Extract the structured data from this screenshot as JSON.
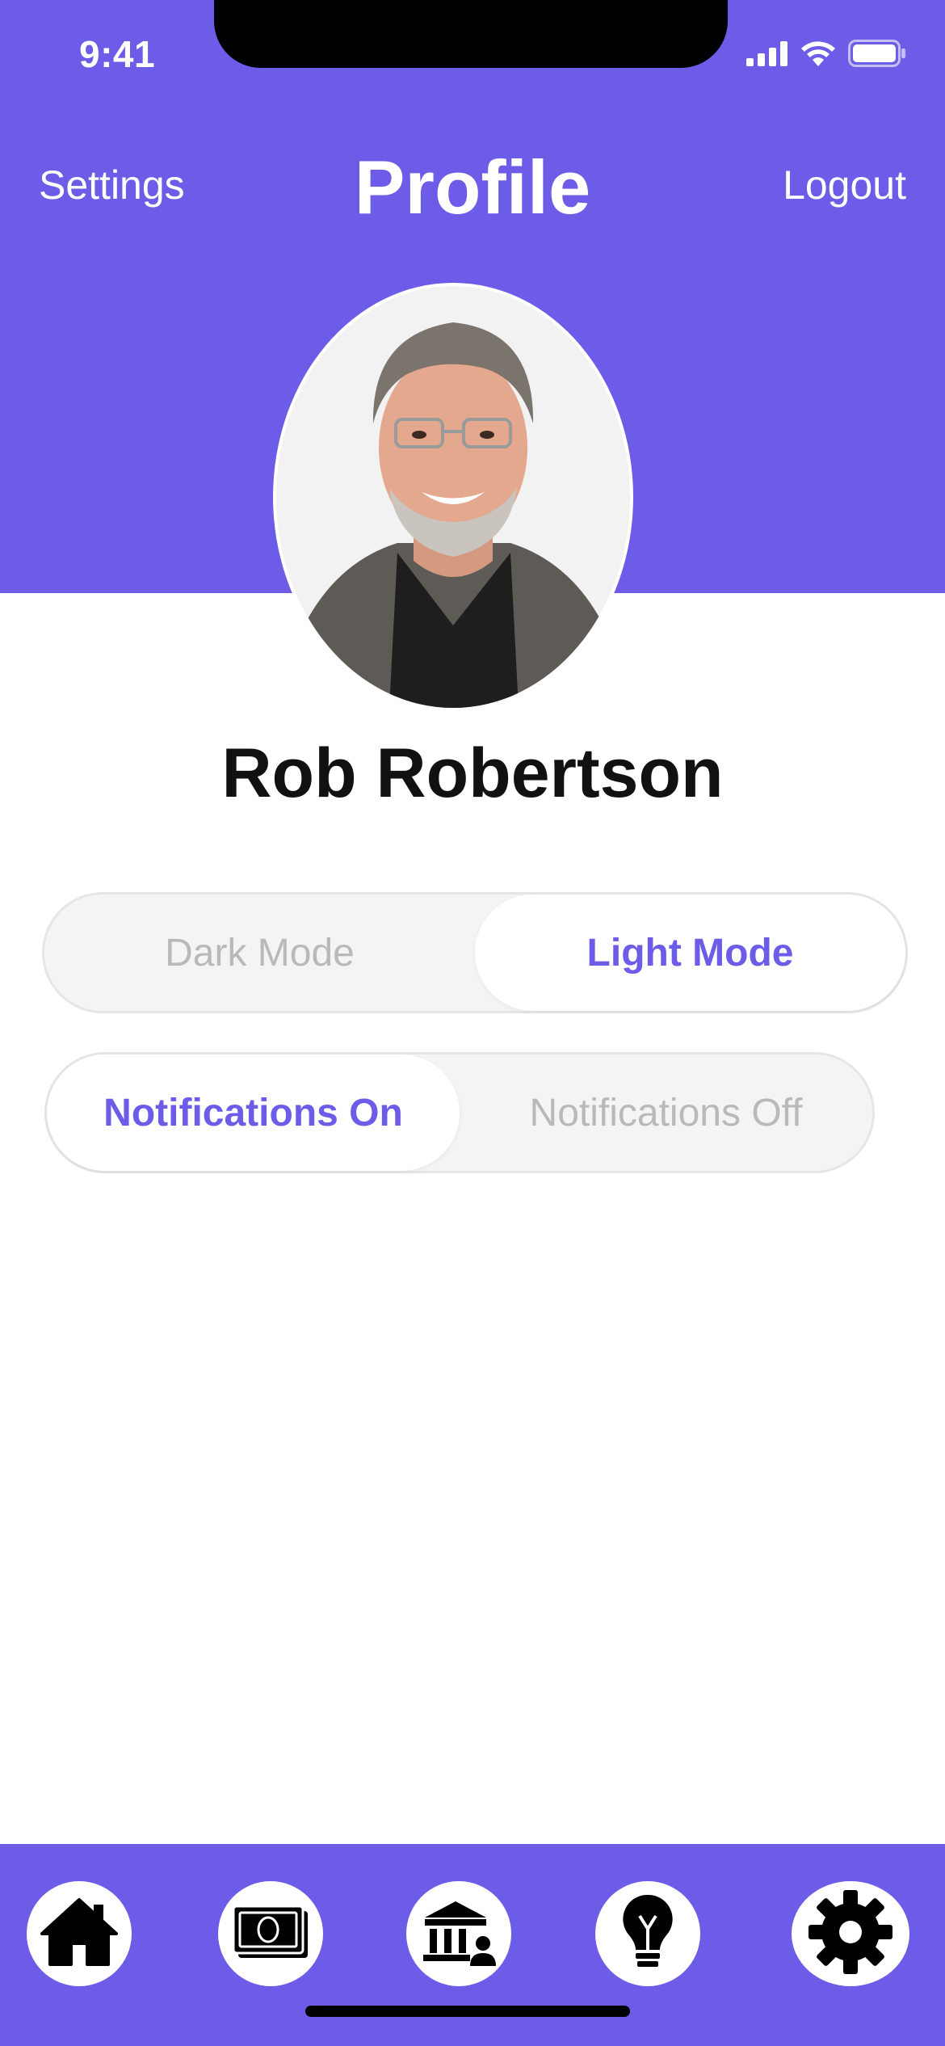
{
  "status_bar": {
    "time": "9:41",
    "signal_icon": "cellular-signal-icon",
    "wifi_icon": "wifi-icon",
    "battery_icon": "battery-icon"
  },
  "header": {
    "left_label": "Settings",
    "title": "Profile",
    "right_label": "Logout"
  },
  "profile": {
    "avatar": "profile-photo",
    "name": "Rob Robertson"
  },
  "theme_toggle": {
    "options": [
      "Dark Mode",
      "Light Mode"
    ],
    "selected": "Light Mode"
  },
  "notifications_toggle": {
    "options": [
      "Notifications On",
      "Notifications Off"
    ],
    "selected": "Notifications On"
  },
  "tab_bar": {
    "items": [
      {
        "icon": "home-icon"
      },
      {
        "icon": "cash-icon"
      },
      {
        "icon": "bank-icon"
      },
      {
        "icon": "lightbulb-icon"
      },
      {
        "icon": "gear-icon"
      }
    ]
  },
  "colors": {
    "brand": "#6c5ce7",
    "background": "#ffffff",
    "inactive_text": "#b9b9b9",
    "segment_bg": "#f4f4f4"
  }
}
